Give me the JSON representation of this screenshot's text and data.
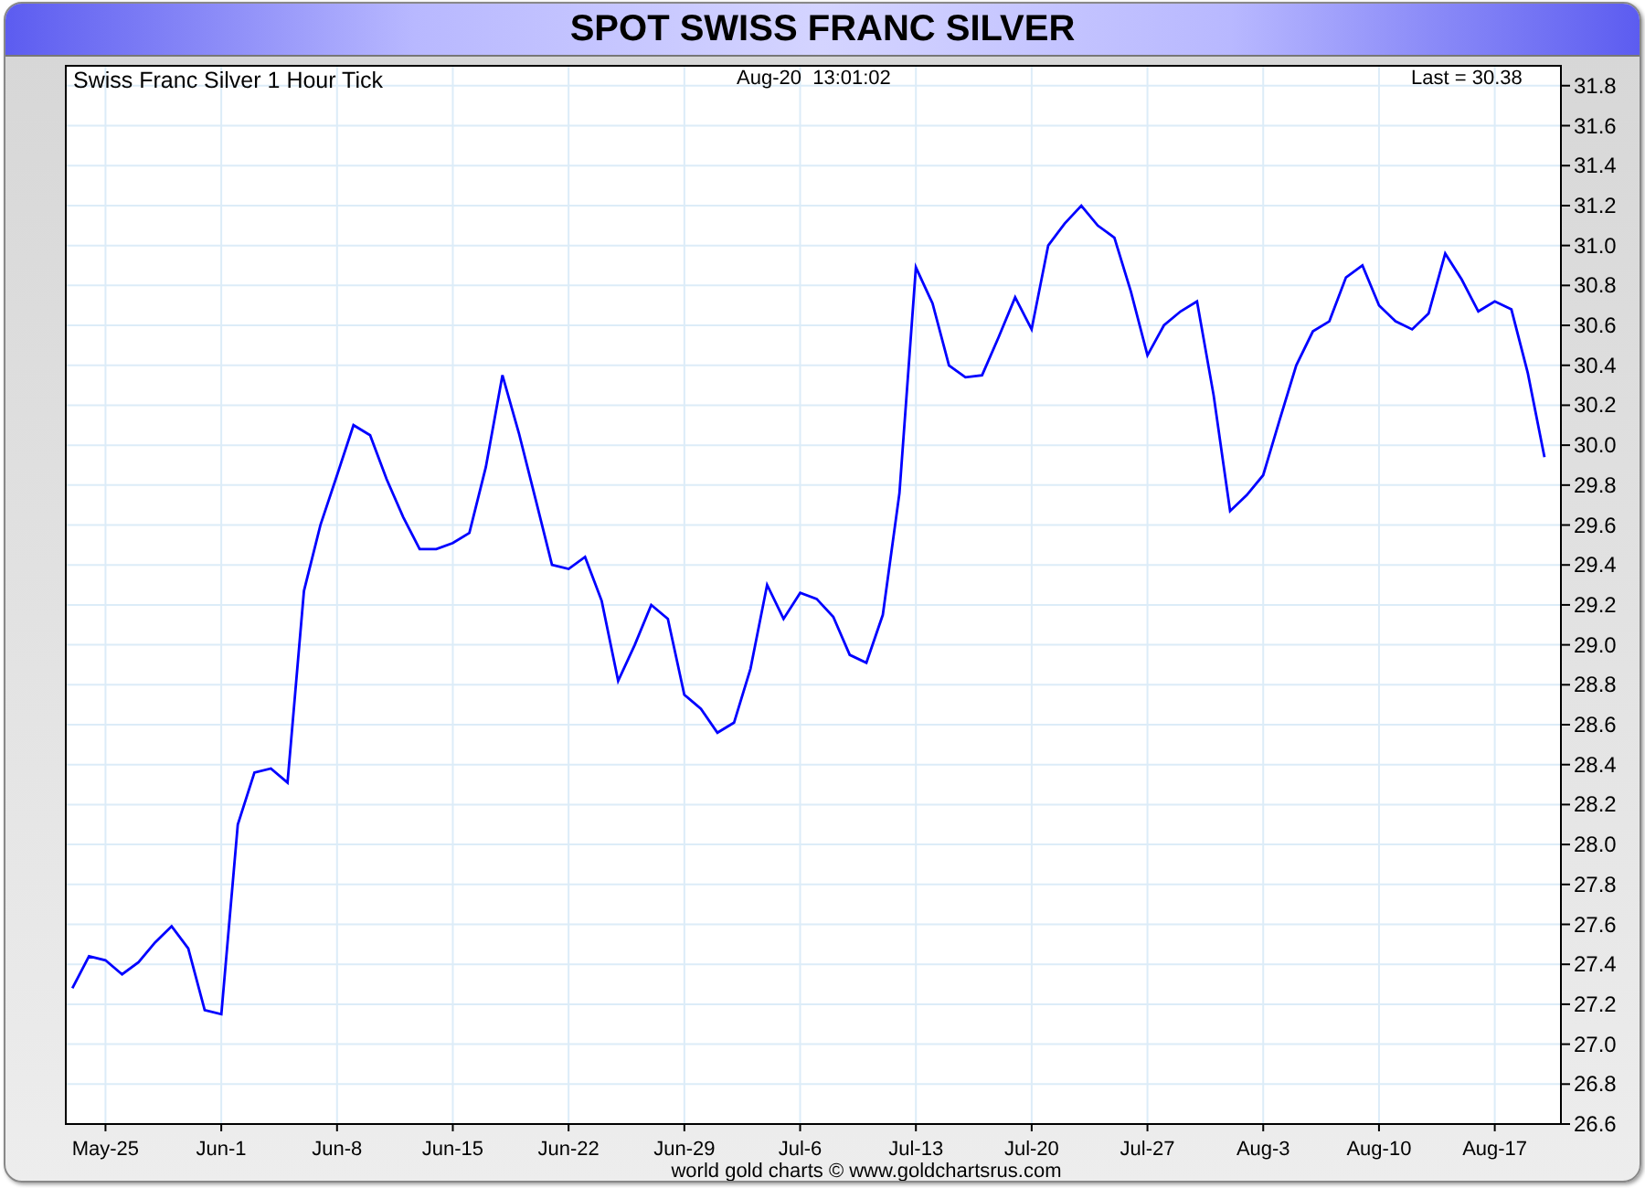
{
  "header": {
    "title": "SPOT SWISS FRANC SILVER"
  },
  "chart": {
    "timestamp": "Aug-20  13:01:02",
    "last_reading": "Last = 30.38",
    "chart_data": {
      "type": "line",
      "title": "Swiss Franc Silver 1 Hour Tick",
      "categories": [
        null,
        null,
        "May-25",
        null,
        null,
        null,
        null,
        null,
        null,
        "Jun-1",
        null,
        null,
        null,
        null,
        null,
        null,
        "Jun-8",
        null,
        null,
        null,
        null,
        null,
        null,
        "Jun-15",
        null,
        null,
        null,
        null,
        null,
        null,
        "Jun-22",
        null,
        null,
        null,
        null,
        null,
        null,
        "Jun-29",
        null,
        null,
        null,
        null,
        null,
        null,
        "Jul-6",
        null,
        null,
        null,
        null,
        null,
        null,
        "Jul-13",
        null,
        null,
        null,
        null,
        null,
        null,
        "Jul-20",
        null,
        null,
        null,
        null,
        null,
        null,
        "Jul-27",
        null,
        null,
        null,
        null,
        null,
        null,
        "Aug-3",
        null,
        null,
        null,
        null,
        null,
        null,
        "Aug-10",
        null,
        null,
        null,
        null,
        null,
        null,
        "Aug-17",
        null,
        null,
        null
      ],
      "series": [
        {
          "color": "#0000ff",
          "values": [
            27.28,
            27.44,
            27.42,
            27.35,
            27.41,
            27.51,
            27.59,
            27.48,
            27.17,
            27.15,
            28.1,
            28.36,
            28.38,
            28.31,
            29.27,
            29.6,
            29.85,
            30.1,
            30.05,
            29.83,
            29.64,
            29.48,
            29.48,
            29.51,
            29.56,
            29.89,
            30.35,
            30.06,
            29.73,
            29.4,
            29.38,
            29.44,
            29.22,
            28.82,
            29.0,
            29.2,
            29.13,
            28.75,
            28.68,
            28.56,
            28.61,
            28.88,
            29.3,
            29.13,
            29.26,
            29.23,
            29.14,
            28.95,
            28.91,
            29.15,
            29.76,
            30.89,
            30.71,
            30.4,
            30.34,
            30.35,
            30.54,
            30.74,
            30.58,
            31.0,
            31.11,
            31.2,
            31.1,
            31.04,
            30.77,
            30.45,
            30.6,
            30.67,
            30.72,
            30.25,
            29.67,
            29.75,
            29.85,
            30.13,
            30.4,
            30.57,
            30.62,
            30.84,
            30.9,
            30.7,
            30.62,
            30.58,
            30.66,
            30.96,
            30.83,
            30.67,
            30.72,
            30.68,
            30.36,
            29.94
          ]
        }
      ],
      "ylim": [
        26.6,
        31.9
      ],
      "grid": true,
      "yticks": [
        26.6,
        26.8,
        {
          "value": 27,
          "label": "27.0"
        },
        27.2,
        27.4,
        27.6,
        27.8,
        {
          "value": 28,
          "label": "28.0"
        },
        28.2,
        28.4,
        28.6,
        28.8,
        {
          "value": 29,
          "label": "29.0"
        },
        29.2,
        29.4,
        29.6,
        29.8,
        {
          "value": 30,
          "label": "30.0"
        },
        30.2,
        30.4,
        30.6,
        30.8,
        {
          "value": 31,
          "label": "31.0"
        },
        31.2,
        31.4,
        31.6,
        31.8
      ]
    }
  },
  "footer": "world gold charts © www.goldchartsrus.com"
}
